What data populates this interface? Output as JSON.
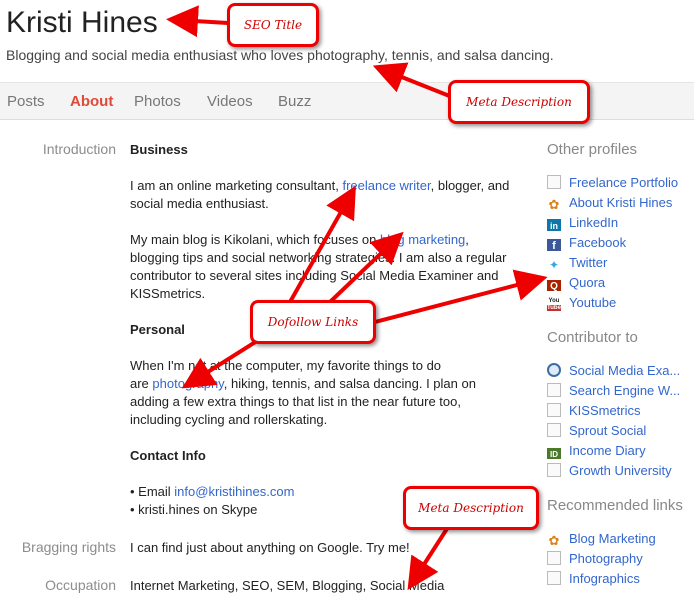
{
  "profile": {
    "name": "Kristi Hines",
    "tagline": "Blogging and social media enthusiast who loves photography, tennis, and salsa dancing."
  },
  "tabs": [
    {
      "label": "Posts",
      "active": false
    },
    {
      "label": "About",
      "active": true
    },
    {
      "label": "Photos",
      "active": false
    },
    {
      "label": "Videos",
      "active": false
    },
    {
      "label": "Buzz",
      "active": false
    }
  ],
  "introduction": {
    "label": "Introduction",
    "business_heading": "Business",
    "business_p1_a": "I am an online marketing consultant, ",
    "business_p1_link": "freelance writer",
    "business_p1_b": ", blogger, and",
    "business_p1_c": "social media enthusiast.",
    "business_p2_a": "My main blog is Kikolani, which focuses on ",
    "business_p2_link": "blog marketing",
    "business_p2_b": ",",
    "business_p2_c": "blogging tips and social networking strategies. I am also a regular",
    "business_p2_d": "contributor to several sites including Social Media Examiner and",
    "business_p2_e": "KISSmetrics.",
    "personal_heading": "Personal",
    "personal_a": "When I'm not at the computer, my favorite things to do",
    "personal_b1": "are ",
    "personal_link": "photography",
    "personal_b2": ", hiking, tennis, and salsa dancing.  I plan on",
    "personal_c": "adding a few extra things to that list in the near future too,",
    "personal_d": "including cycling and rollerskating.",
    "contact_heading": "Contact Info",
    "email_prefix": "• Email ",
    "email_link": "info@kristihines.com",
    "skype": "• kristi.hines on Skype"
  },
  "bragging": {
    "label": "Bragging rights",
    "value": "I can find just about anything on Google. Try me!"
  },
  "occupation": {
    "label": "Occupation",
    "value": "Internet Marketing, SEO, SEM, Blogging, Social Media"
  },
  "sidebar": {
    "other_profiles_heading": "Other profiles",
    "other_profiles": [
      {
        "label": "Freelance Portfolio",
        "icon": "blank-page-icon"
      },
      {
        "label": "About Kristi Hines",
        "icon": "butterfly-icon"
      },
      {
        "label": "LinkedIn",
        "icon": "linkedin-icon"
      },
      {
        "label": "Facebook",
        "icon": "facebook-icon"
      },
      {
        "label": "Twitter",
        "icon": "twitter-bird-icon"
      },
      {
        "label": "Quora",
        "icon": "quora-icon"
      },
      {
        "label": "Youtube",
        "icon": "youtube-icon"
      }
    ],
    "contributor_heading": "Contributor to",
    "contributor": [
      {
        "label": "Social Media Exa...",
        "icon": "magnifier-icon"
      },
      {
        "label": "Search Engine W...",
        "icon": "blank-page-icon"
      },
      {
        "label": "KISSmetrics",
        "icon": "blank-page-icon"
      },
      {
        "label": "Sprout Social",
        "icon": "blank-page-icon"
      },
      {
        "label": "Income Diary",
        "icon": "id-icon"
      },
      {
        "label": "Growth University",
        "icon": "blank-page-icon"
      }
    ],
    "recommended_heading": "Recommended links",
    "recommended": [
      {
        "label": "Blog Marketing",
        "icon": "butterfly-icon"
      },
      {
        "label": "Photography",
        "icon": "blank-page-icon"
      },
      {
        "label": "Infographics",
        "icon": "blank-page-icon"
      }
    ]
  },
  "annotations": {
    "seo_title": "SEO Title",
    "meta_description_top": "Meta Description",
    "dofollow_links": "Dofollow Links",
    "meta_description_bottom": "Meta Description",
    "callout_color": "#e00000"
  }
}
